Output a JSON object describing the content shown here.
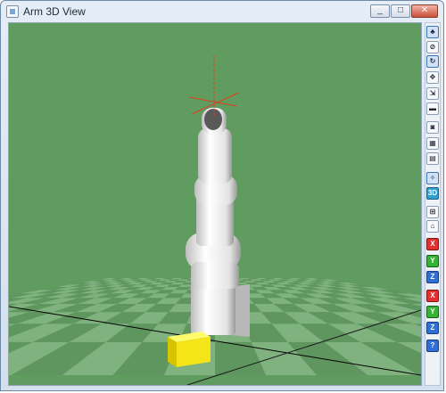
{
  "window": {
    "title": "Arm 3D View",
    "controls": {
      "minimize": "_",
      "maximize": "□",
      "close": "✕"
    }
  },
  "colors": {
    "background": "#609c5f",
    "grid_light": "#7fb27e",
    "grid_dark": "#5f955f",
    "arm": "#f1f1f1",
    "cube": "#f5e418",
    "axis_red": "#e23b1e"
  },
  "toolbar": {
    "items": [
      {
        "name": "view-robot-icon",
        "glyph": "♣",
        "style": "selected"
      },
      {
        "name": "no-entry-icon",
        "glyph": "⊘",
        "style": ""
      },
      {
        "name": "rotate-view-icon",
        "glyph": "↻",
        "style": "selected"
      },
      {
        "name": "pan-view-icon",
        "glyph": "✥",
        "style": ""
      },
      {
        "name": "move-object-icon",
        "glyph": "⇲",
        "style": ""
      },
      {
        "name": "ruler-icon",
        "glyph": "▬",
        "style": ""
      },
      {
        "name": "camera-icon",
        "glyph": "◙",
        "style": ""
      },
      {
        "name": "film-icon",
        "glyph": "▦",
        "style": ""
      },
      {
        "name": "film-strip-icon",
        "glyph": "▤",
        "style": ""
      },
      {
        "name": "tool-frame-icon",
        "glyph": "✧",
        "style": "selected"
      },
      {
        "name": "3d-view-icon",
        "glyph": "3D",
        "style": "cyan"
      },
      {
        "name": "grid-robot-icon",
        "glyph": "⊞",
        "style": ""
      },
      {
        "name": "home-icon",
        "glyph": "⌂",
        "style": ""
      },
      {
        "name": "rotate-x-positive-icon",
        "glyph": "X",
        "style": "red"
      },
      {
        "name": "rotate-y-positive-icon",
        "glyph": "Y",
        "style": "green"
      },
      {
        "name": "rotate-z-positive-icon",
        "glyph": "Z",
        "style": "blue"
      },
      {
        "name": "rotate-x-negative-icon",
        "glyph": "X",
        "style": "red"
      },
      {
        "name": "rotate-y-negative-icon",
        "glyph": "Y",
        "style": "green"
      },
      {
        "name": "rotate-z-negative-icon",
        "glyph": "Z",
        "style": "blue"
      },
      {
        "name": "help-icon",
        "glyph": "?",
        "style": "blue"
      }
    ]
  }
}
